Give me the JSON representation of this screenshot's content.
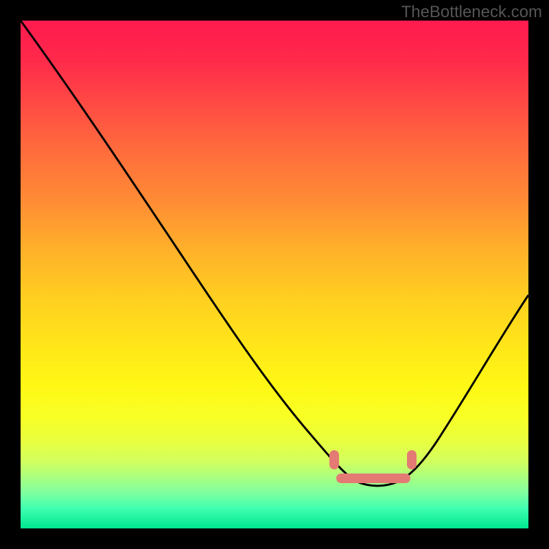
{
  "watermark": "TheBottleneck.com",
  "chart_data": {
    "type": "line",
    "title": "",
    "xlabel": "",
    "ylabel": "",
    "xlim": [
      0,
      100
    ],
    "ylim": [
      0,
      100
    ],
    "x": [
      0,
      5,
      10,
      15,
      20,
      25,
      30,
      35,
      40,
      45,
      50,
      55,
      60,
      62,
      65,
      68,
      70,
      73,
      77,
      80,
      85,
      90,
      95,
      100
    ],
    "values": [
      100,
      92,
      84,
      76,
      68,
      60,
      52,
      44,
      36,
      28,
      20,
      13,
      8,
      6,
      4,
      3,
      3,
      3,
      4,
      7,
      15,
      28,
      42,
      56
    ],
    "background_gradient": {
      "top_color": "#ff1a4f",
      "mid_color": "#ffd020",
      "bottom_color": "#00e890"
    },
    "markers": [
      {
        "type": "pill-vertical",
        "x": 62,
        "y": 12,
        "color": "#e47a74"
      },
      {
        "type": "pill-vertical",
        "x": 77,
        "y": 12,
        "color": "#e47a74"
      },
      {
        "type": "pill-horizontal",
        "x_start": 63,
        "x_end": 77,
        "y": 8,
        "color": "#e47a74"
      }
    ],
    "annotations": []
  }
}
